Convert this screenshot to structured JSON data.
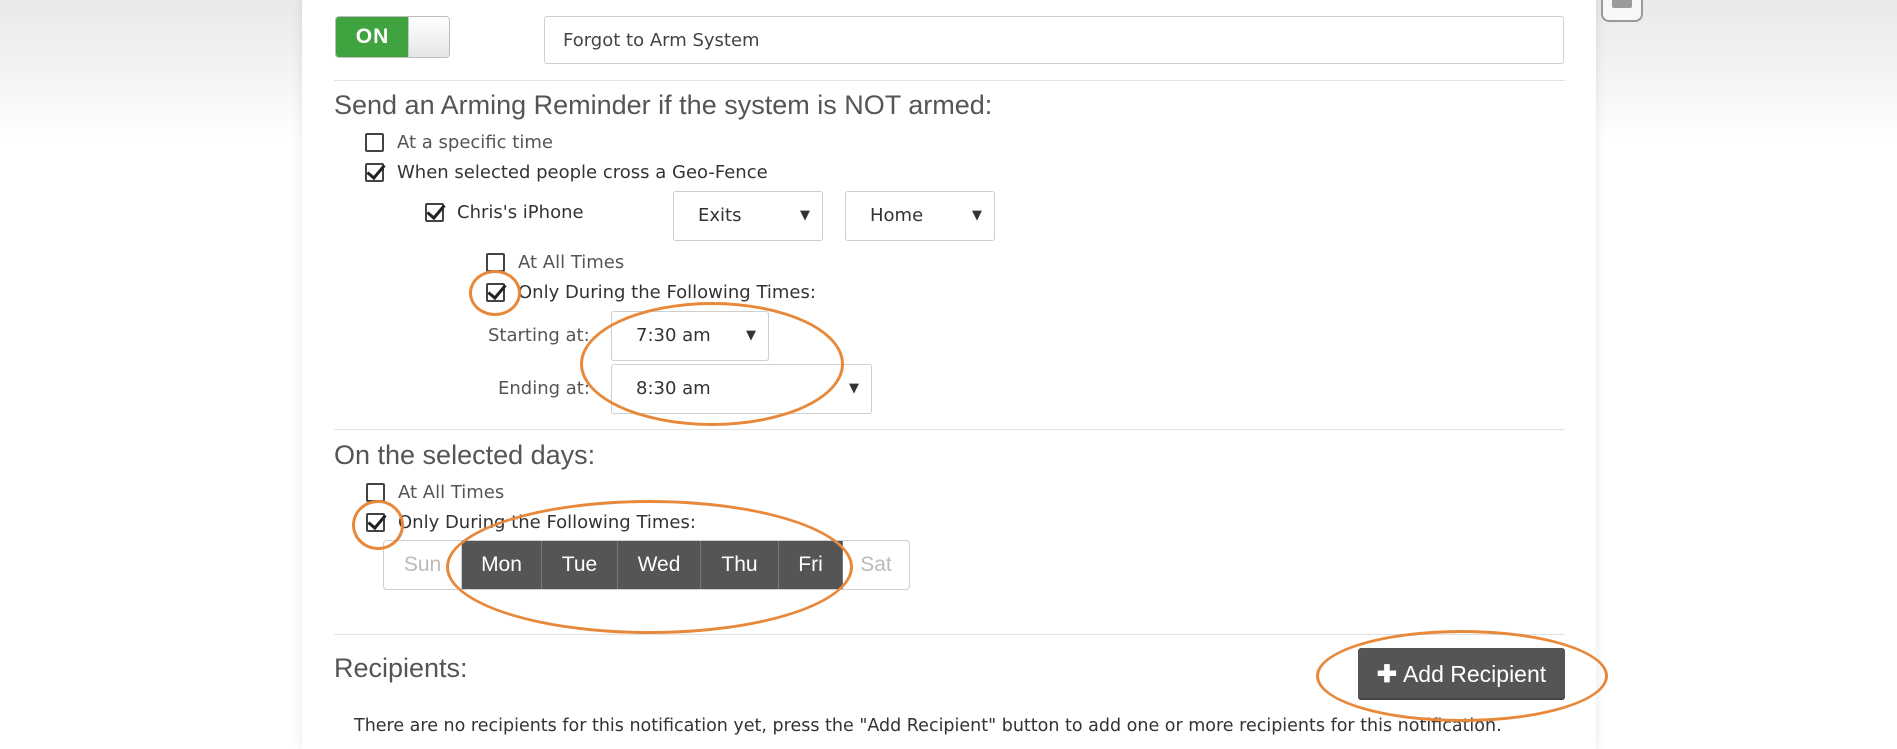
{
  "toggle": {
    "label": "ON"
  },
  "notification_name": {
    "value": "Forgot to Arm System"
  },
  "reminder": {
    "heading": "Send an Arming Reminder if the system is NOT armed:",
    "option_specific_time": "At a specific time",
    "option_geofence": "When selected people cross a Geo-Fence",
    "person": "Chris's iPhone",
    "direction": "Exits",
    "location": "Home",
    "at_all_times": "At All Times",
    "only_during": "Only During the Following Times:",
    "starting_label": "Starting at:",
    "starting_value": "7:30 am",
    "ending_label": "Ending at:",
    "ending_value": "8:30 am"
  },
  "days": {
    "heading": "On the selected days:",
    "at_all_times": "At All Times",
    "only_during": "Only During the Following Times:",
    "items": [
      {
        "label": "Sun",
        "active": false
      },
      {
        "label": "Mon",
        "active": true
      },
      {
        "label": "Tue",
        "active": true
      },
      {
        "label": "Wed",
        "active": true
      },
      {
        "label": "Thu",
        "active": true
      },
      {
        "label": "Fri",
        "active": true
      },
      {
        "label": "Sat",
        "active": false
      }
    ]
  },
  "recipients": {
    "heading": "Recipients:",
    "add_label": "Add Recipient",
    "empty_note": "There are no recipients for this notification yet, press the \"Add Recipient\" button to add one or more recipients for this notification."
  },
  "colors": {
    "toggle_on": "#3fa43f",
    "active_day": "#555555",
    "annotation": "#e8883a"
  },
  "icons": {
    "caret": "caret-down-icon",
    "plus": "plus-icon",
    "camera": "video-camera-icon"
  }
}
